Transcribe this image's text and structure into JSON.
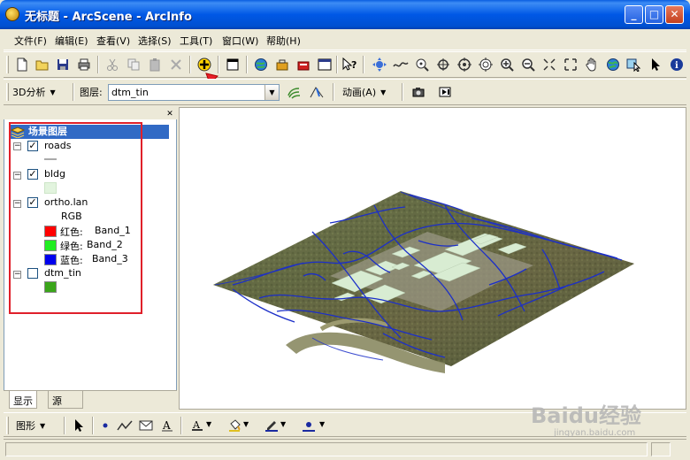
{
  "window": {
    "title": "无标题 - ArcScene - ArcInfo",
    "minimize_icon": "minimize-icon",
    "maximize_icon": "maximize-icon",
    "close_icon": "close-icon"
  },
  "menu": [
    "文件(F)",
    "编辑(E)",
    "查看(V)",
    "选择(S)",
    "工具(T)",
    "窗口(W)",
    "帮助(H)"
  ],
  "toolbar2": {
    "analysis_label": "3D分析",
    "layer_label": "图层:",
    "layer_value": "dtm_tin",
    "animation_label": "动画(A)"
  },
  "toc": {
    "root_label": "场景图层",
    "layers": [
      {
        "name": "roads",
        "checked": true
      },
      {
        "name": "bldg",
        "checked": true
      },
      {
        "name": "ortho.lan",
        "checked": true,
        "renderer": "RGB",
        "bands": [
          {
            "label": "红色:",
            "band": "Band_1",
            "color": "#ff0000"
          },
          {
            "label": "绿色:",
            "band": "Band_2",
            "color": "#22ee22"
          },
          {
            "label": "蓝色:",
            "band": "Band_3",
            "color": "#0000ee"
          }
        ]
      },
      {
        "name": "dtm_tin",
        "checked": false,
        "symbol_color": "#3aa51a"
      }
    ],
    "tabs": [
      "显示",
      "源"
    ]
  },
  "bottom_toolbar": {
    "drawing_label": "图形"
  },
  "watermark": {
    "brand": "Baidu经验",
    "url": "jingyan.baidu.com"
  },
  "colors": {
    "titlebar": "#0058e6",
    "selection": "#316ac5",
    "highlight_box": "#e0202a",
    "roads": "#1c2fc8",
    "buildings": "#d8ecd2"
  }
}
